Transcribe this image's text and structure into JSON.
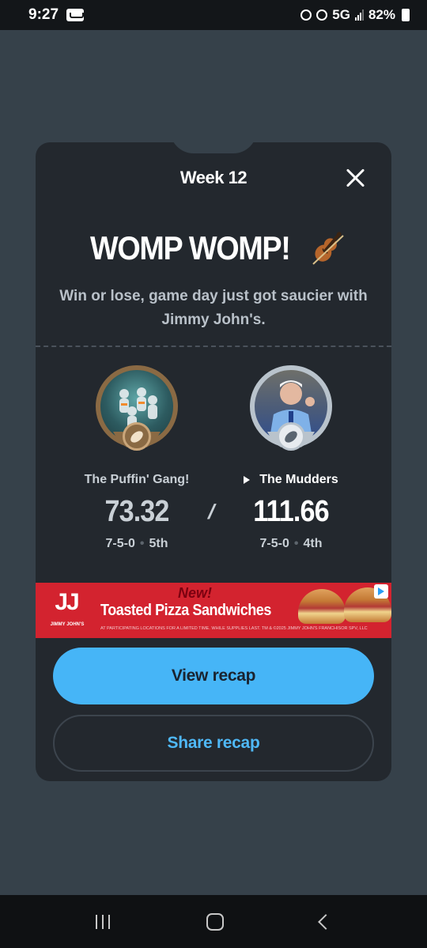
{
  "status_bar": {
    "time": "9:27",
    "network": "5G",
    "battery": "82%",
    "icons": [
      "voicemail-icon",
      "data-saver-icon",
      "alarm-icon",
      "signal-icon",
      "battery-icon"
    ]
  },
  "modal": {
    "week_title": "Week 12",
    "headline": "WOMP WOMP!",
    "headline_icon": "violin-icon",
    "subtitle": "Win or lose, game day just got saucier with Jimmy John's.",
    "teams": [
      {
        "name": "The Puffin' Gang!",
        "score": "73.32",
        "record": "7-5-0",
        "rank": "5th",
        "badge": "gold",
        "winner": false
      },
      {
        "name": "The Mudders",
        "score": "111.66",
        "record": "7-5-0",
        "rank": "4th",
        "badge": "silver",
        "winner": true
      }
    ],
    "separator": "/",
    "ad": {
      "logo": "JJ",
      "logo_sub": "JIMMY JOHN'S",
      "new_label": "New!",
      "title": "Toasted Pizza Sandwiches",
      "fine_print": "AT PARTICIPATING LOCATIONS FOR A LIMITED TIME. WHILE SUPPLIES LAST. TM & ©2025 JIMMY JOHN'S FRANCHISOR SPV, LLC"
    },
    "buttons": {
      "view_recap": "View recap",
      "share_recap": "Share recap"
    }
  },
  "colors": {
    "background": "#36414a",
    "modal": "#23282e",
    "primary_button": "#46b5f7",
    "ad_red": "#d3232f"
  }
}
